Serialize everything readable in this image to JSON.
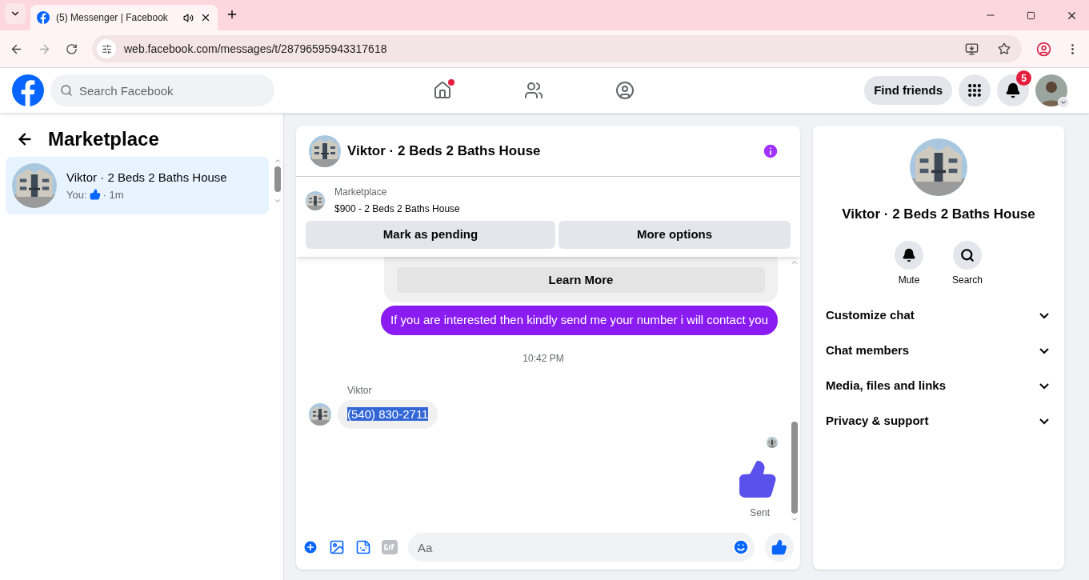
{
  "browser": {
    "tab_title": "(5) Messenger | Facebook",
    "url": "web.facebook.com/messages/t/28796595943317618"
  },
  "topbar": {
    "search_placeholder": "Search Facebook",
    "find_friends": "Find friends",
    "notification_count": "5"
  },
  "sidebar": {
    "title": "Marketplace",
    "conversations": [
      {
        "name": "Viktor · 2 Beds 2 Baths House",
        "preview": "You:",
        "time": "· 1m",
        "selected": true
      }
    ]
  },
  "chat": {
    "title": "Viktor · 2 Beds 2 Baths House",
    "listing": {
      "label": "Marketplace",
      "title": "$900 - 2 Beds 2 Baths House"
    },
    "actions": [
      "Mark as pending",
      "More options"
    ],
    "messages": [
      {
        "kind": "notice",
        "button": "Learn More"
      },
      {
        "kind": "outgoing",
        "text": "If you are interested then kindly send me your number i will contact you"
      },
      {
        "kind": "timestamp",
        "text": "10:42 PM"
      },
      {
        "kind": "incoming",
        "sender": "Viktor",
        "text": "(540) 830-2711",
        "highlighted": true
      },
      {
        "kind": "like",
        "status": "Sent"
      }
    ],
    "composer": {
      "placeholder": "Aa"
    }
  },
  "details": {
    "name": "Viktor · 2 Beds 2 Baths House",
    "actions": [
      {
        "kind": "mute",
        "label": "Mute"
      },
      {
        "kind": "search",
        "label": "Search"
      }
    ],
    "sections": [
      {
        "label": "Customize chat",
        "expanded": false
      },
      {
        "label": "Chat members",
        "expanded": false
      },
      {
        "label": "Media, files and links",
        "expanded": false
      },
      {
        "label": "Privacy & support",
        "expanded": false
      }
    ]
  }
}
